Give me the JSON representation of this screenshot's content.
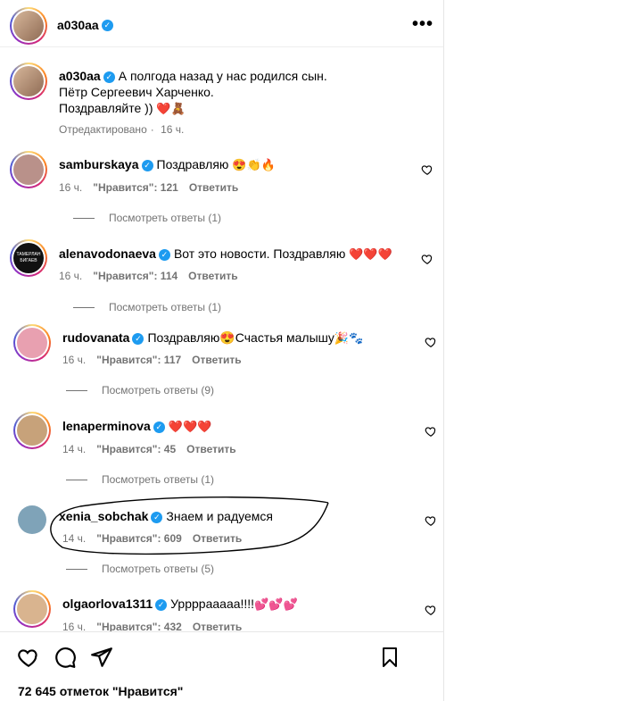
{
  "header": {
    "username": "a030aa",
    "more_icon": "more-horizontal-icon"
  },
  "post": {
    "username": "a030aa",
    "caption_line1": "А полгода назад у нас родился сын.",
    "caption_line2": "Пётр Сергеевич Харченко.",
    "caption_line3": "Поздравляйте ))",
    "caption_emojis": "❤️🧸",
    "edited": "Отредактировано",
    "time": "16 ч."
  },
  "comments": [
    {
      "username": "samburskaya",
      "text": "Поздравляю",
      "emojis": "😍👏🔥",
      "time": "16 ч.",
      "likes": "\"Нравится\": 121",
      "reply": "Ответить",
      "view_replies": "Посмотреть ответы (1)",
      "avatar_color": "#b9918a"
    },
    {
      "username": "alenavodonaeva",
      "text": "Вот это новости. Поздравляю",
      "emojis": "❤️❤️❤️",
      "time": "16 ч.",
      "likes": "\"Нравится\": 114",
      "reply": "Ответить",
      "view_replies": "Посмотреть ответы (1)",
      "avatar_text": "ТАМЕРЛАН БИГАЕВ",
      "avatar_color": "#111111"
    },
    {
      "username": "rudovanata",
      "text": "Поздравляю😍Счастья малышу",
      "emojis": "🎉🐾",
      "time": "16 ч.",
      "likes": "\"Нравится\": 117",
      "reply": "Ответить",
      "view_replies": "Посмотреть ответы (9)",
      "avatar_color": "#e8a0b0"
    },
    {
      "username": "lenaperminova",
      "text": "",
      "emojis": "❤️❤️❤️",
      "time": "14 ч.",
      "likes": "\"Нравится\": 45",
      "reply": "Ответить",
      "view_replies": "Посмотреть ответы (1)",
      "avatar_color": "#c7a27a"
    },
    {
      "username": "xenia_sobchak",
      "text": "Знаем и радуемся",
      "emojis": "",
      "time": "14 ч.",
      "likes": "\"Нравится\": 609",
      "reply": "Ответить",
      "view_replies": "Посмотреть ответы (5)",
      "avatar_color": "#7fa3b8"
    },
    {
      "username": "olgaorlova1311",
      "text": "Уррррааааа!!!!",
      "emojis": "💕💕💕",
      "time": "16 ч.",
      "likes": "\"Нравится\": 432",
      "reply": "Ответить",
      "avatar_color": "#d9b48f"
    }
  ],
  "actions": {
    "like_icon": "heart-icon",
    "comment_icon": "comment-icon",
    "share_icon": "send-icon",
    "save_icon": "bookmark-icon"
  },
  "likes_total": "72 645 отметок \"Нравится\"",
  "colors": {
    "verified": "#1d9bf0",
    "muted": "#737373",
    "heart": "#e0245e"
  }
}
